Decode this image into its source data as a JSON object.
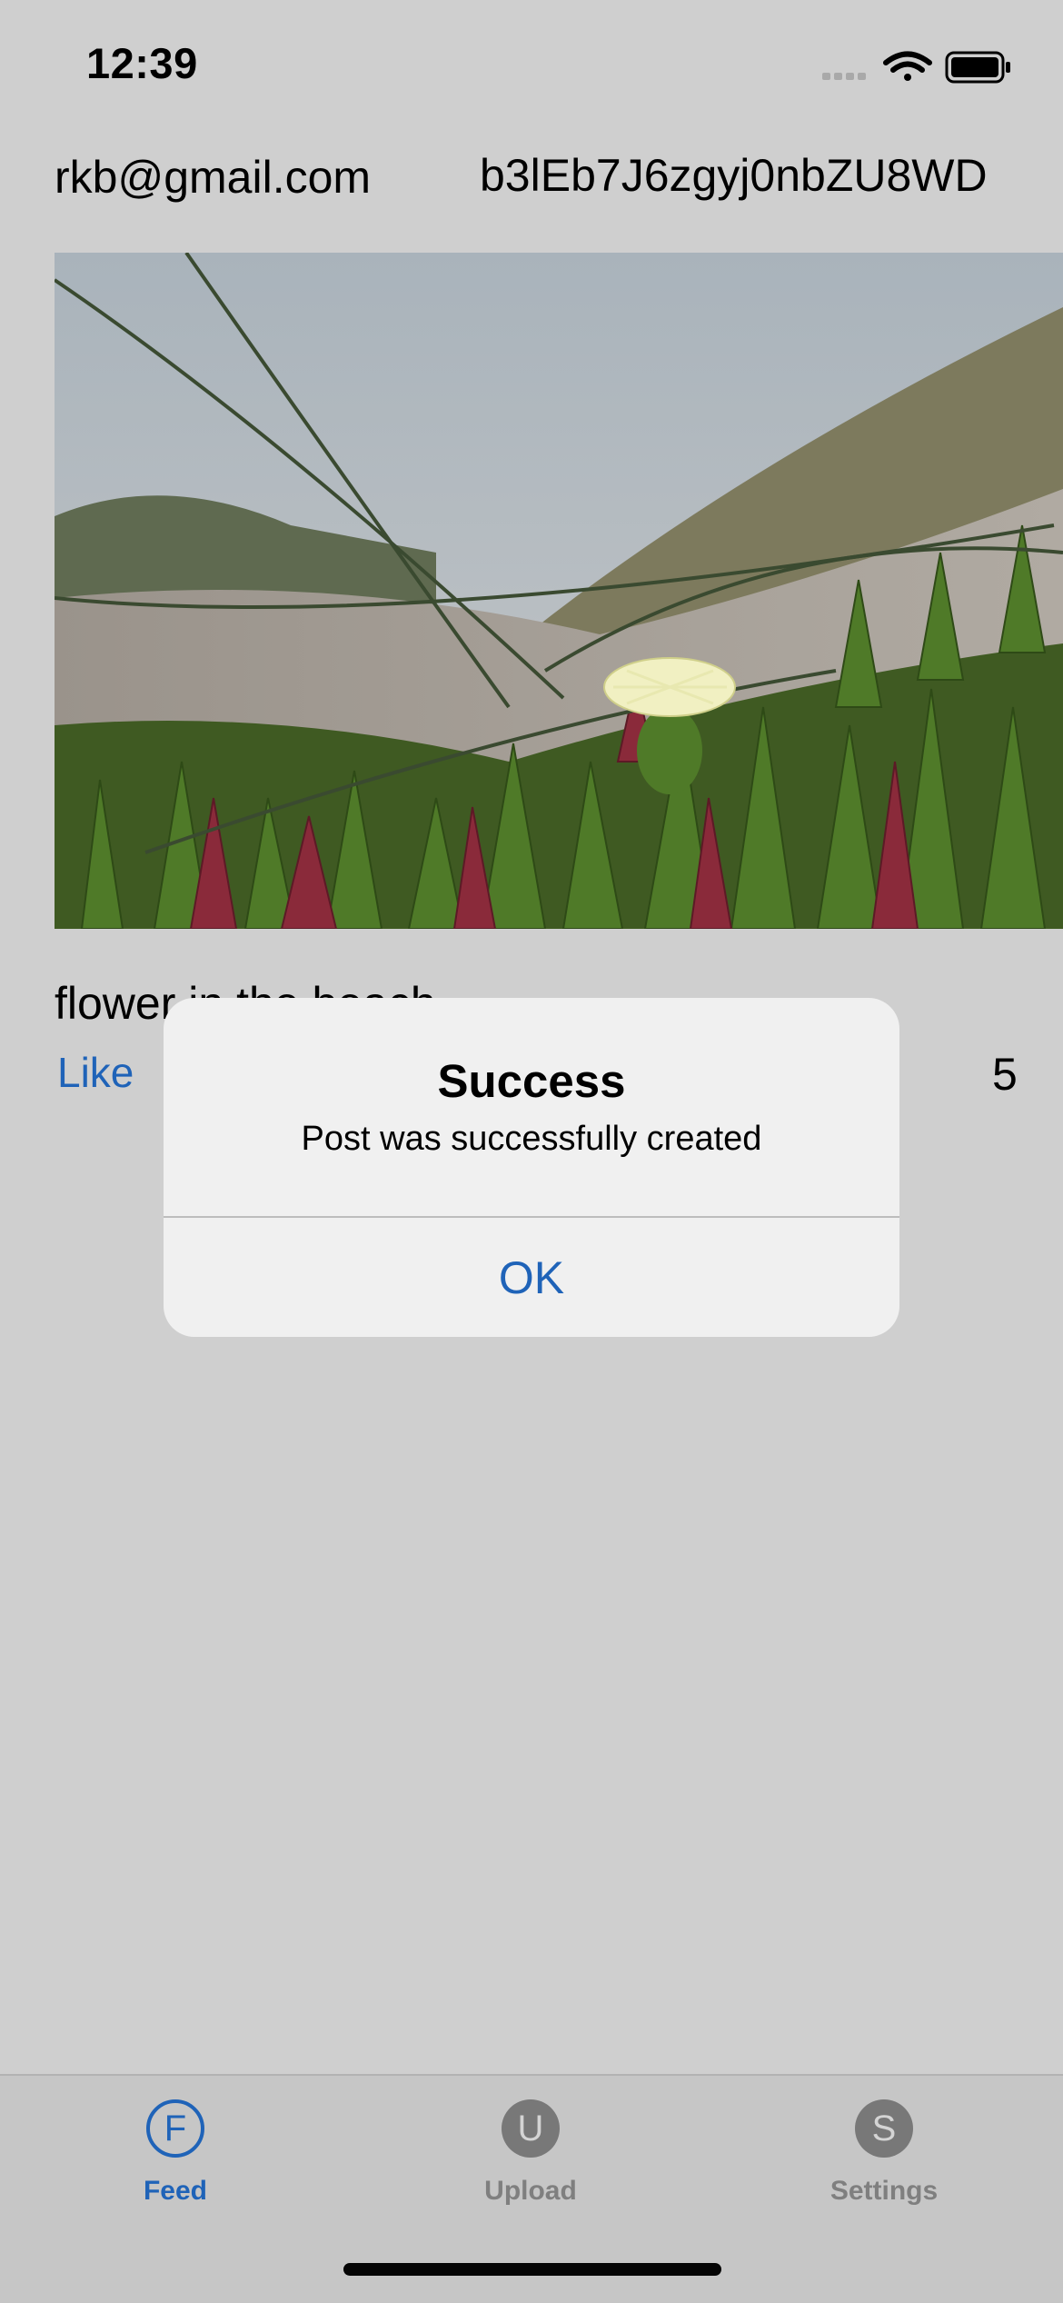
{
  "status_bar": {
    "time": "12:39",
    "icons": [
      "cellular-signal-icon",
      "wifi-icon",
      "battery-icon"
    ]
  },
  "header": {
    "email": "rkb@gmail.com",
    "user_id": "b3lEb7J6zgyj0nbZU8WD"
  },
  "post": {
    "caption": "flower in the beach",
    "like_label": "Like",
    "like_count": "5"
  },
  "alert": {
    "title": "Success",
    "message": "Post was successfully created",
    "ok_label": "OK"
  },
  "tabbar": {
    "tabs": [
      {
        "letter": "F",
        "label": "Feed",
        "selected": true
      },
      {
        "letter": "U",
        "label": "Upload",
        "selected": false
      },
      {
        "letter": "S",
        "label": "Settings",
        "selected": false
      }
    ]
  },
  "colors": {
    "background_dimmed": "#cfcfcf",
    "accent": "#1f63b8",
    "alert_background": "#f0f0f0",
    "tab_inactive": "#787878"
  }
}
